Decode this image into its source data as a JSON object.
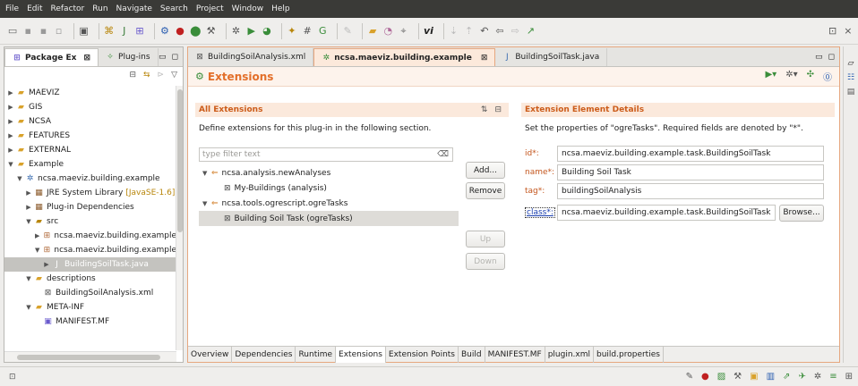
{
  "menu": [
    "File",
    "Edit",
    "Refactor",
    "Run",
    "Navigate",
    "Search",
    "Project",
    "Window",
    "Help"
  ],
  "colors": {
    "accent": "#e36f2a",
    "section_bg": "#fbe9dc",
    "selection": "#dedcd8"
  },
  "package_explorer": {
    "tabs": [
      {
        "label": "Package Ex"
      },
      {
        "label": "Plug-ins"
      }
    ],
    "tree": [
      {
        "label": "MAEVIZ",
        "indent": 0,
        "arrow": "▶",
        "icon": "project-icon"
      },
      {
        "label": "GIS",
        "indent": 0,
        "arrow": "▶",
        "icon": "project-icon"
      },
      {
        "label": "NCSA",
        "indent": 0,
        "arrow": "▶",
        "icon": "project-icon"
      },
      {
        "label": "FEATURES",
        "indent": 0,
        "arrow": "▶",
        "icon": "project-icon"
      },
      {
        "label": "EXTERNAL",
        "indent": 0,
        "arrow": "▶",
        "icon": "project-icon"
      },
      {
        "label": "Example",
        "indent": 0,
        "arrow": "▼",
        "icon": "project-icon"
      },
      {
        "label": "ncsa.maeviz.building.example",
        "indent": 1,
        "arrow": "▼",
        "icon": "plugin-project-icon"
      },
      {
        "label": "JRE System Library",
        "suffix": "[JavaSE-1.6]",
        "indent": 2,
        "arrow": "▶",
        "icon": "library-icon"
      },
      {
        "label": "Plug-in Dependencies",
        "indent": 2,
        "arrow": "▶",
        "icon": "library-icon"
      },
      {
        "label": "src",
        "indent": 2,
        "arrow": "▼",
        "icon": "source-folder-icon"
      },
      {
        "label": "ncsa.maeviz.building.example",
        "indent": 3,
        "arrow": "▶",
        "icon": "package-icon"
      },
      {
        "label": "ncsa.maeviz.building.example",
        "indent": 3,
        "arrow": "▼",
        "icon": "package-icon"
      },
      {
        "label": "BuildingSoilTask.java",
        "indent": 4,
        "arrow": "▶",
        "icon": "java-file-icon",
        "selected": true
      },
      {
        "label": "descriptions",
        "indent": 2,
        "arrow": "▼",
        "icon": "folder-icon"
      },
      {
        "label": "BuildingSoilAnalysis.xml",
        "indent": 3,
        "arrow": "",
        "icon": "xml-file-icon"
      },
      {
        "label": "META-INF",
        "indent": 2,
        "arrow": "▼",
        "icon": "folder-icon"
      },
      {
        "label": "MANIFEST.MF",
        "indent": 3,
        "arrow": "",
        "icon": "manifest-icon"
      }
    ]
  },
  "editor": {
    "tabs": [
      {
        "label": "BuildingSoilAnalysis.xml",
        "active": false
      },
      {
        "label": "ncsa.maeviz.building.example",
        "active": true
      },
      {
        "label": "BuildingSoilTask.java",
        "active": false
      }
    ],
    "form_title": "Extensions",
    "all_extensions": {
      "title": "All Extensions",
      "description": "Define extensions for this plug-in in the following section.",
      "filter_placeholder": "type filter text",
      "items": [
        {
          "label": "ncsa.analysis.newAnalyses",
          "level": 0,
          "arrow": "▼"
        },
        {
          "label": "My-Buildings (analysis)",
          "level": 1,
          "arrow": ""
        },
        {
          "label": "ncsa.tools.ogrescript.ogreTasks",
          "level": 0,
          "arrow": "▼"
        },
        {
          "label": "Building Soil Task (ogreTasks)",
          "level": 1,
          "arrow": "",
          "selected": true
        }
      ],
      "buttons": {
        "add": "Add...",
        "remove": "Remove",
        "up": "Up",
        "down": "Down"
      }
    },
    "details": {
      "title": "Extension Element Details",
      "description": "Set the properties of \"ogreTasks\". Required fields are denoted by \"*\".",
      "fields": {
        "id": {
          "label": "id*:",
          "value": "ncsa.maeviz.building.example.task.BuildingSoilTask"
        },
        "name": {
          "label": "name*:",
          "value": "Building Soil Task"
        },
        "tag": {
          "label": "tag*:",
          "value": "buildingSoilAnalysis"
        },
        "class": {
          "label": "class*:",
          "value": "ncsa.maeviz.building.example.task.BuildingSoilTask"
        }
      },
      "browse": "Browse..."
    },
    "bottom_tabs": [
      "Overview",
      "Dependencies",
      "Runtime",
      "Extensions",
      "Extension Points",
      "Build",
      "MANIFEST.MF",
      "plugin.xml",
      "build.properties"
    ],
    "active_bottom_tab": "Extensions"
  }
}
